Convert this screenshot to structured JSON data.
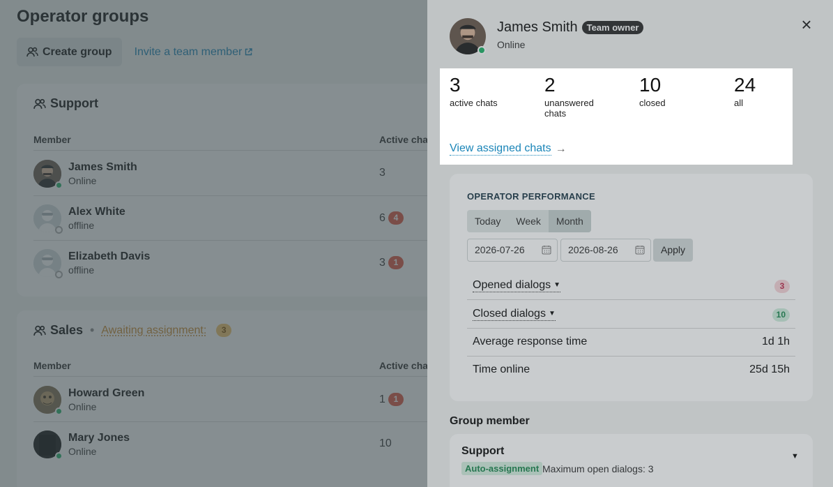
{
  "page": {
    "title": "Operator groups",
    "create_group_label": "Create group",
    "invite_label": "Invite a team member"
  },
  "groups": [
    {
      "name": "Support",
      "header_member": "Member",
      "header_active": "Active chats",
      "members": [
        {
          "name": "James Smith",
          "status": "Online",
          "online": true,
          "active": "3",
          "badge": ""
        },
        {
          "name": "Alex White",
          "status": "offline",
          "online": false,
          "active": "6",
          "badge": "4"
        },
        {
          "name": "Elizabeth Davis",
          "status": "offline",
          "online": false,
          "active": "3",
          "badge": "1"
        }
      ]
    },
    {
      "name": "Sales",
      "awaiting_label": "Awaiting assignment:",
      "awaiting_count": "3",
      "header_member": "Member",
      "header_active": "Active chats",
      "members": [
        {
          "name": "Howard Green",
          "status": "Online",
          "online": true,
          "active": "1",
          "badge": "1"
        },
        {
          "name": "Mary Jones",
          "status": "Online",
          "online": true,
          "active": "10",
          "badge": ""
        }
      ]
    }
  ],
  "panel": {
    "name": "James Smith",
    "role_badge": "Team owner",
    "status": "Online",
    "close_icon": "×",
    "stats": [
      {
        "value": "3",
        "label": "active chats"
      },
      {
        "value": "2",
        "label": "unanswered chats"
      },
      {
        "value": "10",
        "label": "closed"
      },
      {
        "value": "24",
        "label": "all"
      }
    ],
    "view_assigned_label": "View assigned chats",
    "performance": {
      "title": "OPERATOR PERFORMANCE",
      "periods": [
        "Today",
        "Week",
        "Month"
      ],
      "selected_period": "Month",
      "date_from": "2026-07-26",
      "date_to": "2026-08-26",
      "apply_label": "Apply",
      "metrics": [
        {
          "label": "Opened dialogs",
          "value": "3",
          "style": "pink"
        },
        {
          "label": "Closed dialogs",
          "value": "10",
          "style": "green"
        },
        {
          "label": "Average response time",
          "value": "1d 1h",
          "style": "text"
        },
        {
          "label": "Time online",
          "value": "25d 15h",
          "style": "text"
        }
      ]
    },
    "group_member": {
      "title": "Group member",
      "group_name": "Support",
      "auto_assignment_label": "Auto-assignment",
      "max_open_label": "Maximum open dialogs: 3"
    }
  },
  "colors": {
    "accent_link": "#1a85b8",
    "online": "#22b36a",
    "badge_red": "#e0563f",
    "awaiting": "#c9892e"
  }
}
